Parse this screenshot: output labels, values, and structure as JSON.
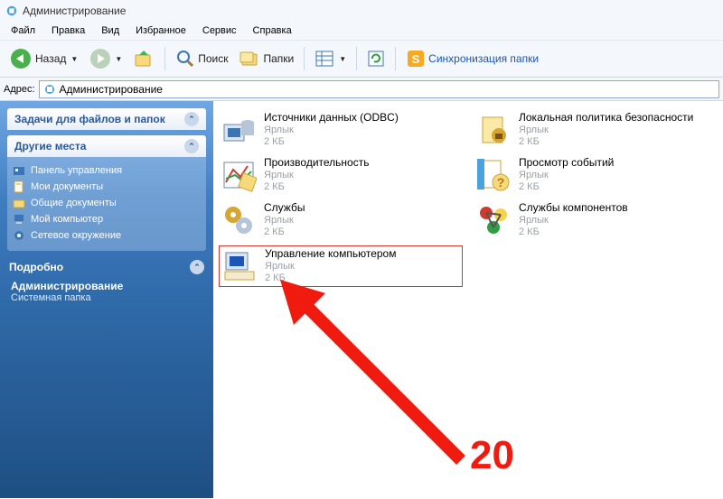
{
  "window": {
    "title": "Администрирование"
  },
  "menu": [
    "Файл",
    "Правка",
    "Вид",
    "Избранное",
    "Сервис",
    "Справка"
  ],
  "toolbar": {
    "back": "Назад",
    "search": "Поиск",
    "folders": "Папки",
    "sync": "Синхронизация папки"
  },
  "address": {
    "label": "Адрес:",
    "value": "Администрирование"
  },
  "sidebar": {
    "section1": {
      "title": "Задачи для файлов и папок"
    },
    "section2": {
      "title": "Другие места",
      "items": [
        "Панель управления",
        "Мои документы",
        "Общие документы",
        "Мой компьютер",
        "Сетевое окружение"
      ]
    },
    "section3": {
      "title": "Подробно",
      "detail_name": "Администрирование",
      "detail_type": "Системная папка"
    }
  },
  "items": [
    {
      "name": "Источники данных (ODBC)",
      "type": "Ярлык",
      "size": "2 КБ"
    },
    {
      "name": "Локальная политика безопасности",
      "type": "Ярлык",
      "size": "2 КБ"
    },
    {
      "name": "Производительность",
      "type": "Ярлык",
      "size": "2 КБ"
    },
    {
      "name": "Просмотр событий",
      "type": "Ярлык",
      "size": "2 КБ"
    },
    {
      "name": "Службы",
      "type": "Ярлык",
      "size": "2 КБ"
    },
    {
      "name": "Службы компонентов",
      "type": "Ярлык",
      "size": "2 КБ"
    },
    {
      "name": "Управление компьютером",
      "type": "Ярлык",
      "size": "2 КБ"
    }
  ],
  "annotation": {
    "number": "20"
  }
}
